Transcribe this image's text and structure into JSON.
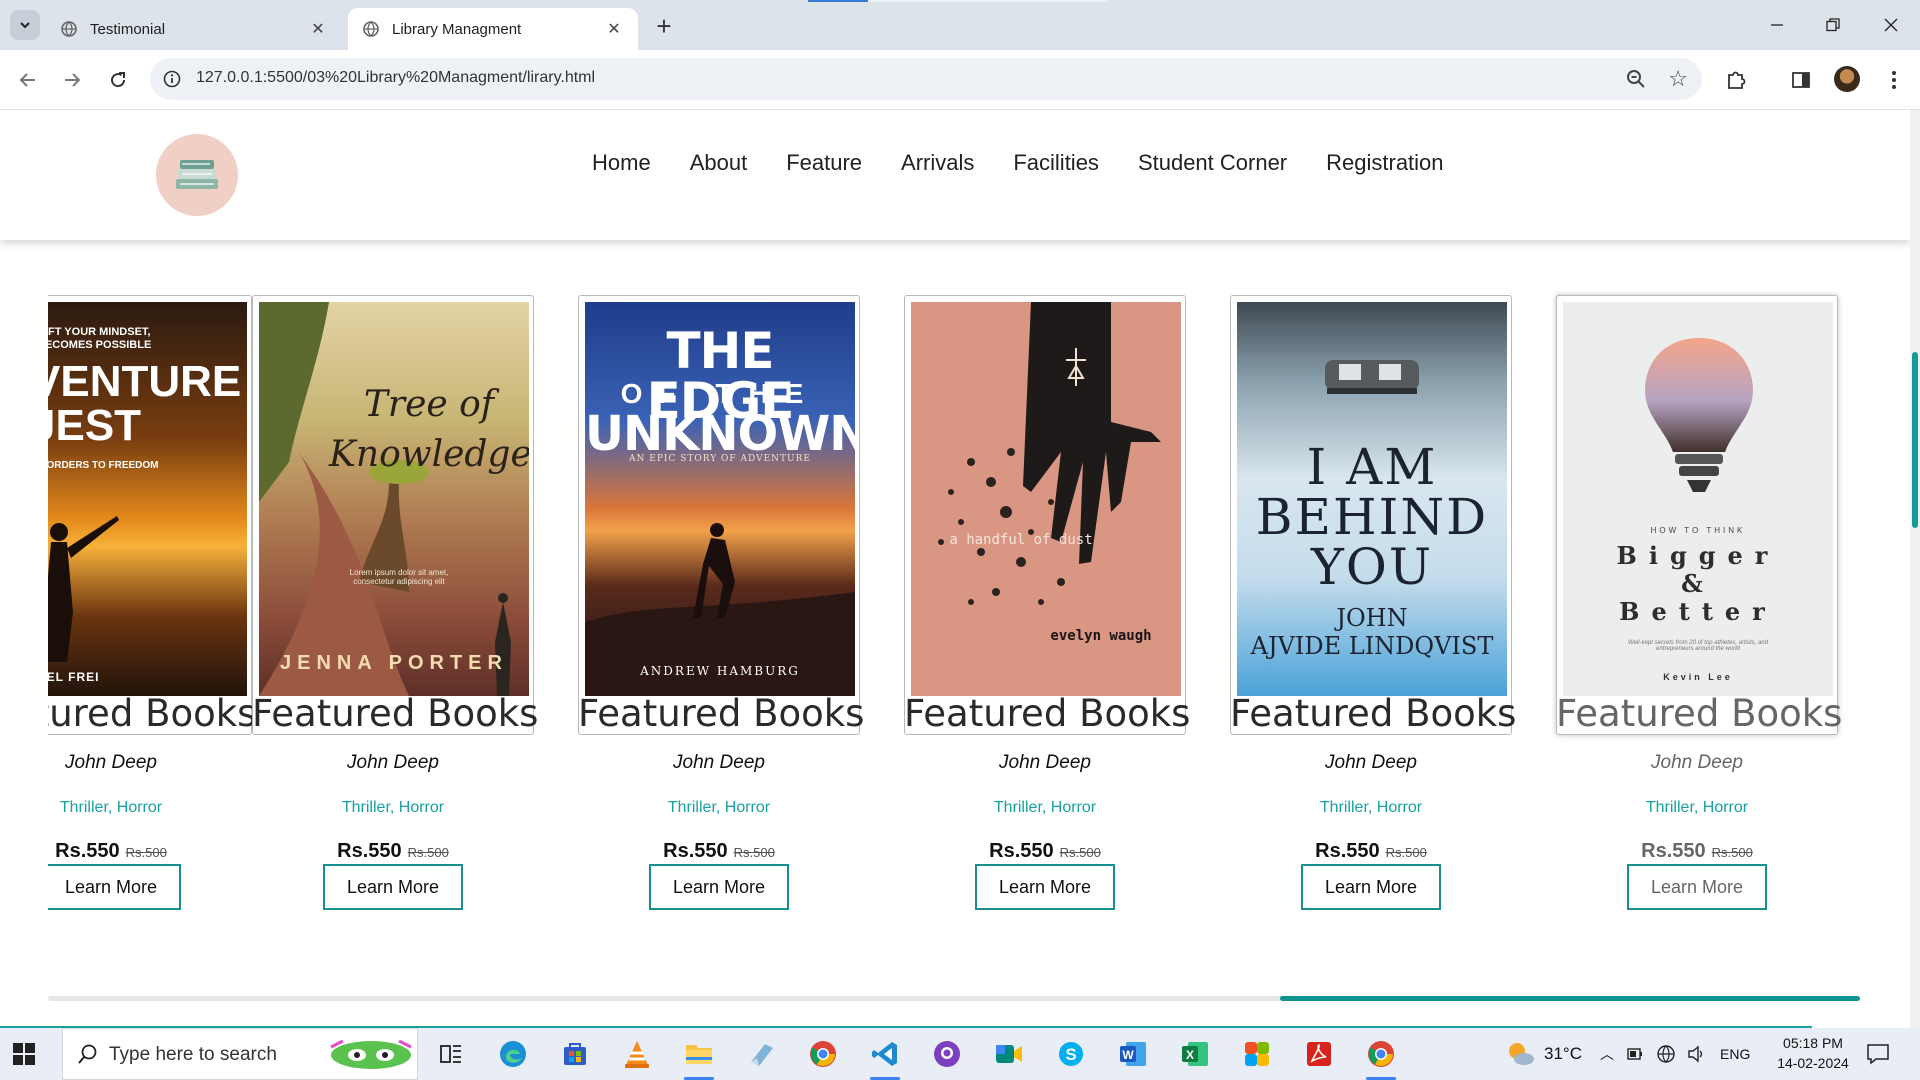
{
  "browser": {
    "tabs": [
      {
        "title": "Testimonial",
        "active": false
      },
      {
        "title": "Library Managment",
        "active": true
      }
    ],
    "url": "127.0.0.1:5500/03%20Library%20Managment/lirary.html"
  },
  "site": {
    "menu": [
      "Home",
      "About",
      "Feature",
      "Arrivals",
      "Facilities",
      "Student Corner",
      "Registration"
    ]
  },
  "books": [
    {
      "cover_lines": [
        "HIFT YOUR MINDSET,",
        "BECOMES POSSIBLE",
        "VENTURE",
        "JEST",
        "ISORDERS TO FREEDOM",
        "HEL FREI"
      ],
      "title": "Featured Books",
      "author": "John Deep",
      "genre": "Thriller, Horror",
      "price": "Rs.550",
      "old_price": "Rs.500",
      "button": "Learn More"
    },
    {
      "cover_lines": [
        "Tree of",
        "Knowledge",
        "Lorem ipsum dolor sit amet, consectetur adipiscing elit",
        "JENNA PORTER"
      ],
      "title": "Featured Books",
      "author": "John Deep",
      "genre": "Thriller, Horror",
      "price": "Rs.550",
      "old_price": "Rs.500",
      "button": "Learn More"
    },
    {
      "cover_lines": [
        "THE EDGE",
        "OF THE",
        "UNKNOWN",
        "AN EPIC STORY OF ADVENTURE",
        "ANDREW HAMBURG"
      ],
      "title": "Featured Books",
      "author": "John Deep",
      "genre": "Thriller, Horror",
      "price": "Rs.550",
      "old_price": "Rs.500",
      "button": "Learn More"
    },
    {
      "cover_lines": [
        "a handful of dust",
        "evelyn waugh"
      ],
      "title": "Featured Books",
      "author": "John Deep",
      "genre": "Thriller, Horror",
      "price": "Rs.550",
      "old_price": "Rs.500",
      "button": "Learn More"
    },
    {
      "cover_lines": [
        "I AM",
        "BEHIND",
        "YOU",
        "JOHN",
        "AJVIDE LINDQVIST"
      ],
      "title": "Featured Books",
      "author": "John Deep",
      "genre": "Thriller, Horror",
      "price": "Rs.550",
      "old_price": "Rs.500",
      "button": "Learn More"
    },
    {
      "cover_lines": [
        "HOW TO THINK",
        "Bigger",
        "&",
        "Better",
        "Well-kept secrets from 20 of top athletes, artists, and entrepreneurs around the world",
        "Kevin Lee"
      ],
      "title": "Featured Books",
      "author": "John Deep",
      "genre": "Thriller, Horror",
      "price": "Rs.550",
      "old_price": "Rs.500",
      "button": "Learn More"
    }
  ],
  "carousel_scroll_fraction": 0.66,
  "taskbar": {
    "search_placeholder": "Type here to search",
    "weather": "31°C",
    "language": "ENG",
    "time": "05:18 PM",
    "date": "14-02-2024"
  },
  "colors": {
    "accent": "#129a99",
    "genre_text": "#18a0a3",
    "logo_bg": "#f0cfc4",
    "tabbar_bg": "#dde3ea"
  }
}
